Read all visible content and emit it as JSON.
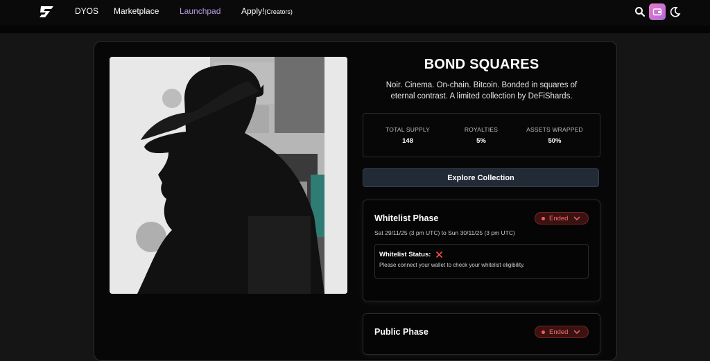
{
  "nav": {
    "links": [
      "DYOS",
      "Marketplace",
      "Launchpad"
    ],
    "apply_label": "Apply!",
    "apply_suffix": "(Creators)",
    "active": "Launchpad",
    "icons": [
      "search-icon",
      "wallet-icon",
      "moon-icon"
    ],
    "wallet_color": "#c873d0"
  },
  "collection": {
    "title": "BOND SQUARES",
    "description": "Noir. Cinema. On-chain. Bitcoin. Bonded in squares of eternal contrast. A limited collection by DeFiShards.",
    "stats": [
      {
        "label": "TOTAL SUPPLY",
        "value": "148"
      },
      {
        "label": "ROYALTIES",
        "value": "5%"
      },
      {
        "label": "ASSETS WRAPPED",
        "value": "50%"
      }
    ],
    "explore_label": "Explore Collection"
  },
  "phases": [
    {
      "title": "Whitelist Phase",
      "status": "Ended",
      "dates": "Sat 29/11/25 (3 pm UTC) to Sun 30/11/25 (3 pm UTC)",
      "wl_status_label": "Whitelist Status:",
      "wl_message": "Please connect your wallet to check your whitelist eligibility."
    },
    {
      "title": "Public Phase",
      "status": "Ended"
    }
  ],
  "colors": {
    "accent": "#b39ce0",
    "ended": "#ff6b6b",
    "button": "#222a36"
  }
}
